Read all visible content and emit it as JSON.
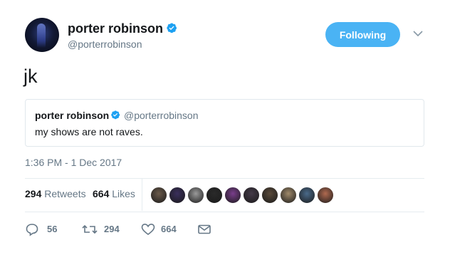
{
  "author": {
    "name": "porter robinson",
    "handle": "@porterrobinson"
  },
  "follow_button": {
    "label": "Following"
  },
  "tweet": {
    "text": "jk",
    "timestamp": "1:36 PM - 1 Dec 2017"
  },
  "quoted_tweet": {
    "name": "porter robinson",
    "handle": "@porterrobinson",
    "text": "my shows are not raves."
  },
  "stats": {
    "retweets_count": "294",
    "retweets_label": "Retweets",
    "likes_count": "664",
    "likes_label": "Likes"
  },
  "likers": [
    {
      "color": "#6b5a4a"
    },
    {
      "color": "#3a2f5c"
    },
    {
      "color": "#9a9a9a"
    },
    {
      "color": "#2a2a2a"
    },
    {
      "color": "#7a3e8c"
    },
    {
      "color": "#443a48"
    },
    {
      "color": "#5a4a3a"
    },
    {
      "color": "#a08a6a"
    },
    {
      "color": "#4a6a8a"
    },
    {
      "color": "#b06a50"
    }
  ],
  "actions": {
    "reply_count": "56",
    "retweet_count": "294",
    "like_count": "664"
  },
  "colors": {
    "accent": "#1da1f2",
    "muted": "#657786",
    "text": "#14171a",
    "border": "#e1e8ed"
  },
  "icons": {
    "verified": "verified-badge-icon",
    "caret": "chevron-down-icon",
    "reply": "reply-icon",
    "retweet": "retweet-icon",
    "like": "heart-icon",
    "dm": "envelope-icon"
  }
}
